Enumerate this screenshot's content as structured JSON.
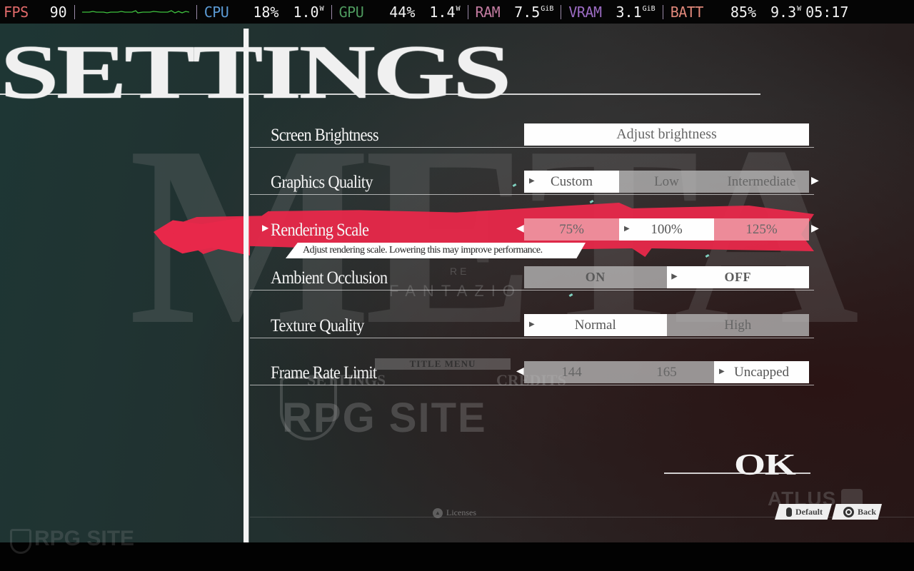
{
  "perf_overlay": {
    "fps": {
      "label": "FPS",
      "value": "90",
      "label_color": "#e06a6a"
    },
    "cpu": {
      "label": "CPU",
      "usage": "18%",
      "power": "1.0",
      "power_unit": "W",
      "label_color": "#5b9bd5"
    },
    "gpu": {
      "label": "GPU",
      "usage": "44%",
      "power": "1.4",
      "power_unit": "W",
      "label_color": "#4e9a5e"
    },
    "ram": {
      "label": "RAM",
      "value": "7.5",
      "unit": "GiB",
      "label_color": "#c27ba0"
    },
    "vram": {
      "label": "VRAM",
      "value": "3.1",
      "unit": "GiB",
      "label_color": "#9b6bc2"
    },
    "batt": {
      "label": "BATT",
      "percent": "85%",
      "power": "9.3",
      "power_unit": "W",
      "time": "05:17",
      "label_color": "#e0887a"
    },
    "frametime_graph_color": "#3fc23f"
  },
  "page": {
    "title": "SETTINGS",
    "accent_color": "#e8284a"
  },
  "background": {
    "watermark_letters": "META",
    "re_text": "RE",
    "fantazio_text": "FANTAZIO",
    "title_menu_text": "TITLE MENU",
    "bg_settings_text": "SETTINGS",
    "bg_credits_text": "CREDITS",
    "watermark_site": "RPG SITE",
    "publisher_logo": "ATLUS"
  },
  "settings": [
    {
      "label": "Screen Brightness",
      "type": "button",
      "button_label": "Adjust brightness"
    },
    {
      "label": "Graphics Quality",
      "type": "selector",
      "options": [
        "Custom",
        "Low",
        "Intermediate"
      ],
      "selected": "Custom"
    },
    {
      "label": "Rendering Scale",
      "type": "selector",
      "focused": true,
      "options": [
        "75%",
        "100%",
        "125%"
      ],
      "selected": "100%",
      "description": "Adjust rendering scale. Lowering this may improve performance."
    },
    {
      "label": "Ambient Occlusion",
      "type": "toggle",
      "options": [
        "ON",
        "OFF"
      ],
      "selected": "OFF"
    },
    {
      "label": "Texture Quality",
      "type": "selector",
      "options": [
        "Normal",
        "High"
      ],
      "selected": "Normal"
    },
    {
      "label": "Frame Rate Limit",
      "type": "selector",
      "options": [
        "144",
        "165",
        "Uncapped"
      ],
      "selected": "Uncapped"
    }
  ],
  "actions": {
    "ok_label": "OK",
    "default_label": "Default",
    "back_label": "Back",
    "licenses_label": "Licenses"
  }
}
